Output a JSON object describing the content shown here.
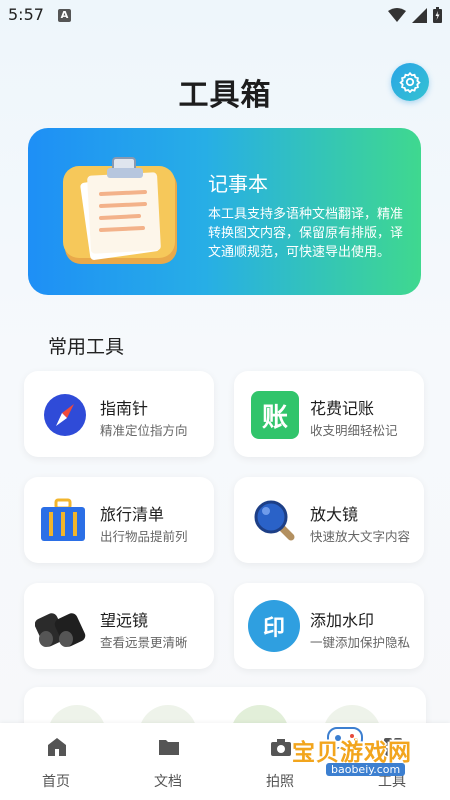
{
  "status": {
    "time": "5:57",
    "indicator": "A"
  },
  "header": {
    "title": "工具箱"
  },
  "banner": {
    "title": "记事本",
    "description": "本工具支持多语种文档翻译，精准转换图文内容，保留原有排版，译文通顺规范，可快速导出使用。"
  },
  "section": {
    "title": "常用工具"
  },
  "tools": [
    {
      "title": "指南针",
      "subtitle": "精准定位指方向",
      "icon": "compass-icon"
    },
    {
      "title": "花费记账",
      "subtitle": "收支明细轻松记",
      "icon": "ledger-icon",
      "icon_text": "账"
    },
    {
      "title": "旅行清单",
      "subtitle": "出行物品提前列",
      "icon": "suitcase-icon"
    },
    {
      "title": "放大镜",
      "subtitle": "快速放大文字内容",
      "icon": "magnifier-icon"
    },
    {
      "title": "望远镜",
      "subtitle": "查看远景更清晰",
      "icon": "binoculars-icon"
    },
    {
      "title": "添加水印",
      "subtitle": "一键添加保护隐私",
      "icon": "watermark-icon",
      "icon_text": "印"
    }
  ],
  "tabs": [
    {
      "label": "首页",
      "icon": "home-icon"
    },
    {
      "label": "文档",
      "icon": "folder-icon"
    },
    {
      "label": "拍照",
      "icon": "camera-icon"
    },
    {
      "label": "工具",
      "icon": "tools-icon"
    }
  ],
  "watermark": {
    "text": "宝贝游戏网",
    "url": "baobeiy.com"
  }
}
